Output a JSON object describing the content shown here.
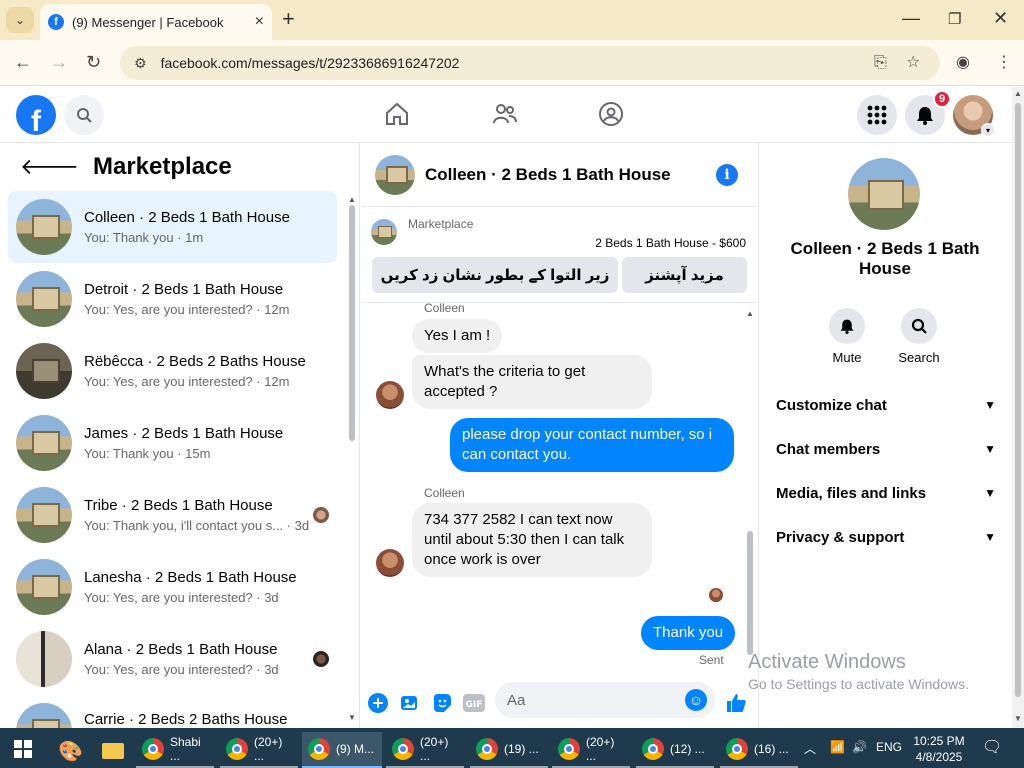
{
  "browser": {
    "tab_title": "(9) Messenger | Facebook",
    "url": "facebook.com/messages/t/29233686916247202"
  },
  "header": {
    "notifications_count": "9"
  },
  "left_panel": {
    "title": "Marketplace",
    "conversations": [
      {
        "name": "Colleen · 2 Beds 1 Bath House",
        "preview": "You: Thank you · 1m",
        "active": true
      },
      {
        "name": "Detroit · 2 Beds 1 Bath House",
        "preview": "You: Yes, are you interested? · 12m"
      },
      {
        "name": "Rëbêcca · 2 Beds 2 Baths House",
        "preview": "You: Yes, are you interested? · 12m"
      },
      {
        "name": "James · 2 Beds 1 Bath House",
        "preview": "You: Thank you · 15m"
      },
      {
        "name": "Tribe · 2 Beds 1 Bath House",
        "preview": "You: Thank you, i'll contact you s... · 3d"
      },
      {
        "name": "Lanesha · 2 Beds 1 Bath House",
        "preview": "You: Yes, are you interested? · 3d"
      },
      {
        "name": "Alana · 2 Beds 1 Bath House",
        "preview": "You: Yes, are you interested? · 3d"
      },
      {
        "name": "Carrie · 2 Beds 2 Baths House",
        "preview": ""
      }
    ]
  },
  "chat": {
    "title": "Colleen · 2 Beds 1 Bath House",
    "marketplace_label": "Marketplace",
    "listing": "2 Beds 1 Bath House - $600",
    "btn_pending": "زیر التوا کے بطور نشان زد کریں",
    "btn_more": "مزید آپشنز",
    "sender_name": "Colleen",
    "messages": [
      {
        "text": "Yes I am !"
      },
      {
        "text": "What's the criteria to get accepted ?"
      },
      {
        "text": "please drop your contact number, so i can contact you."
      },
      {
        "text": "734 377 2582 I can text now until about 5:30 then I can talk once work is over"
      },
      {
        "text": "Thank you"
      }
    ],
    "status": "Sent",
    "composer_placeholder": "Aa"
  },
  "right_panel": {
    "name": "Colleen · 2 Beds 1 Bath House",
    "actions": [
      {
        "label": "Mute"
      },
      {
        "label": "Search"
      }
    ],
    "sections": [
      {
        "label": "Customize chat"
      },
      {
        "label": "Chat members"
      },
      {
        "label": "Media, files and links"
      },
      {
        "label": "Privacy & support"
      }
    ]
  },
  "watermark": {
    "line1": "Activate Windows",
    "line2": "Go to Settings to activate Windows."
  },
  "taskbar": {
    "apps": [
      {
        "label": "Shabi ..."
      },
      {
        "label": "(20+) ..."
      },
      {
        "label": "(9) M..."
      },
      {
        "label": "(20+) ..."
      },
      {
        "label": "(19) ..."
      },
      {
        "label": "(20+) ..."
      },
      {
        "label": "(12) ..."
      },
      {
        "label": "(16) ..."
      }
    ],
    "language": "ENG",
    "time": "10:25 PM",
    "date": "4/8/2025"
  }
}
